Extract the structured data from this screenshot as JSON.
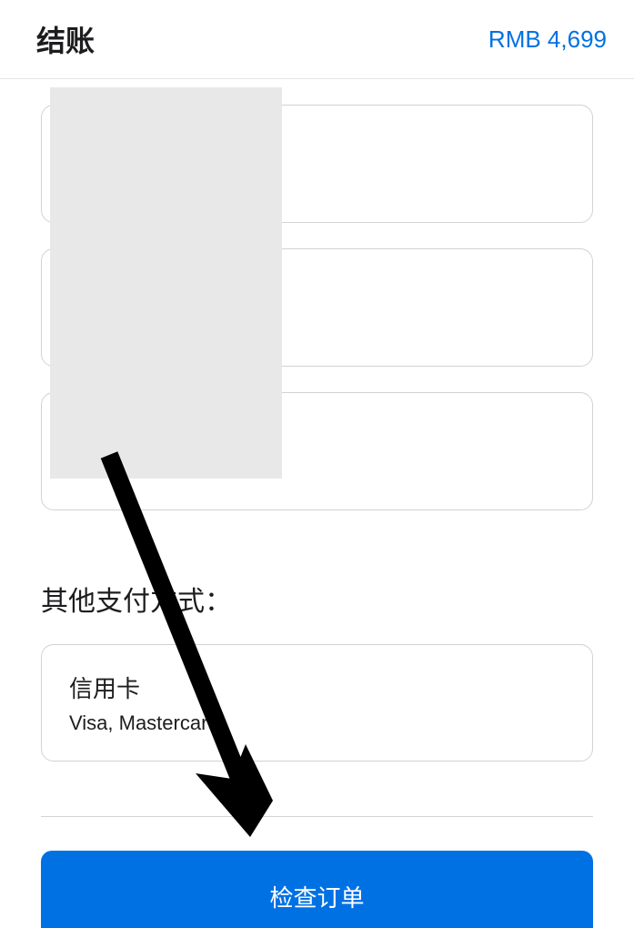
{
  "header": {
    "title": "结账",
    "price": "RMB 4,699"
  },
  "section": {
    "other_payment_title": "其他支付方式："
  },
  "payment": {
    "credit_card": {
      "title": "信用卡",
      "subtitle": "Visa, Mastercard"
    }
  },
  "footer": {
    "checkout_button": "检查订单"
  }
}
